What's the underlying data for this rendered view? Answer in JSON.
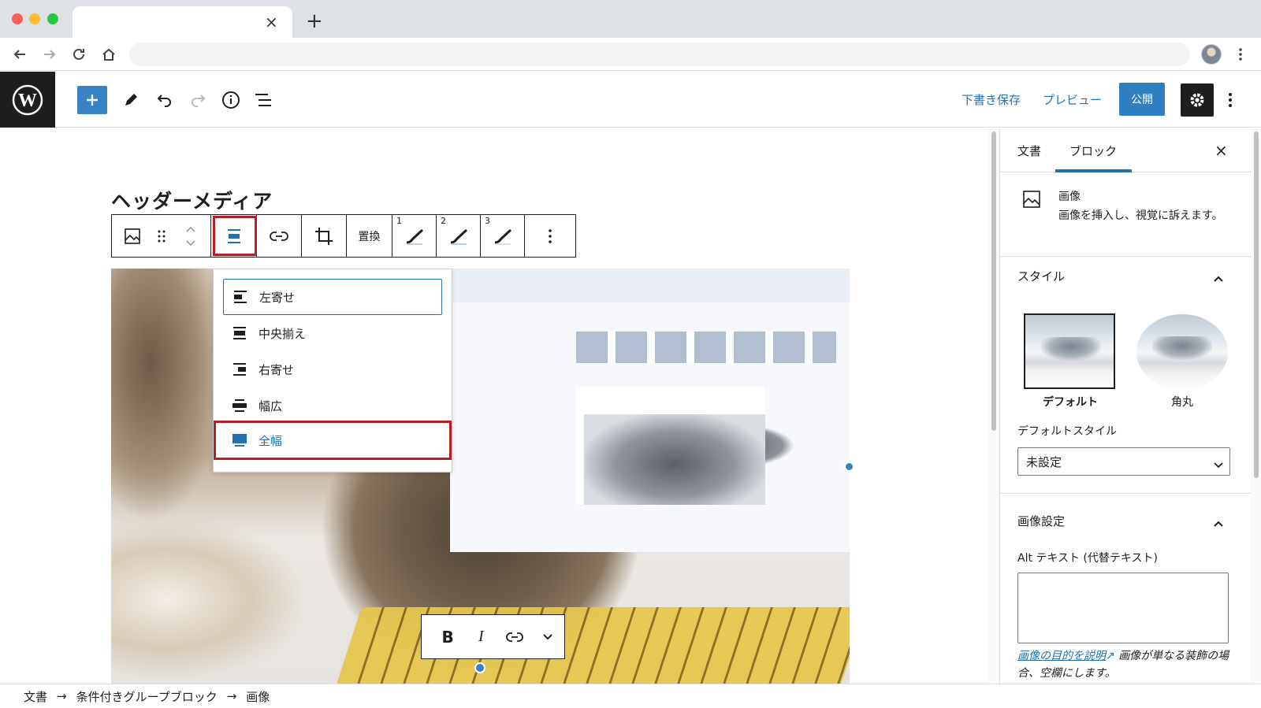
{
  "browser": {
    "tab_close": "×",
    "new_tab": "+"
  },
  "toolbar": {
    "draft_save": "下書き保存",
    "preview": "プレビュー",
    "publish": "公開"
  },
  "editor": {
    "title": "ヘッダーメディア",
    "block_toolbar": {
      "replace": "置換",
      "duotone_1": "1",
      "duotone_2": "2",
      "duotone_3": "3"
    },
    "align_menu": [
      {
        "label": "左寄せ"
      },
      {
        "label": "中央揃え"
      },
      {
        "label": "右寄せ"
      },
      {
        "label": "幅広"
      },
      {
        "label": "全幅"
      }
    ],
    "caption_toolbar": {
      "bold": "B",
      "italic": "I"
    }
  },
  "sidebar": {
    "tab_document": "文書",
    "tab_block": "ブロック",
    "close": "×",
    "block_name": "画像",
    "block_desc": "画像を挿入し、視覚に訴えます。",
    "styles_heading": "スタイル",
    "styles": [
      {
        "label": "デフォルト"
      },
      {
        "label": "角丸"
      }
    ],
    "default_style_label": "デフォルトスタイル",
    "default_style_value": "未設定",
    "image_settings_heading": "画像設定",
    "alt_label": "Alt テキスト (代替テキスト)",
    "alt_help_link": "画像の目的を説明",
    "alt_help_text": "画像が単なる装飾の場合、空欄にします。"
  },
  "footer": {
    "breadcrumb": [
      "文書",
      "条件付きグループブロック",
      "画像"
    ],
    "arrow": "→"
  },
  "colors": {
    "accent": "#2271b1",
    "highlight": "#b41f24",
    "dark": "#1e1e1e"
  }
}
